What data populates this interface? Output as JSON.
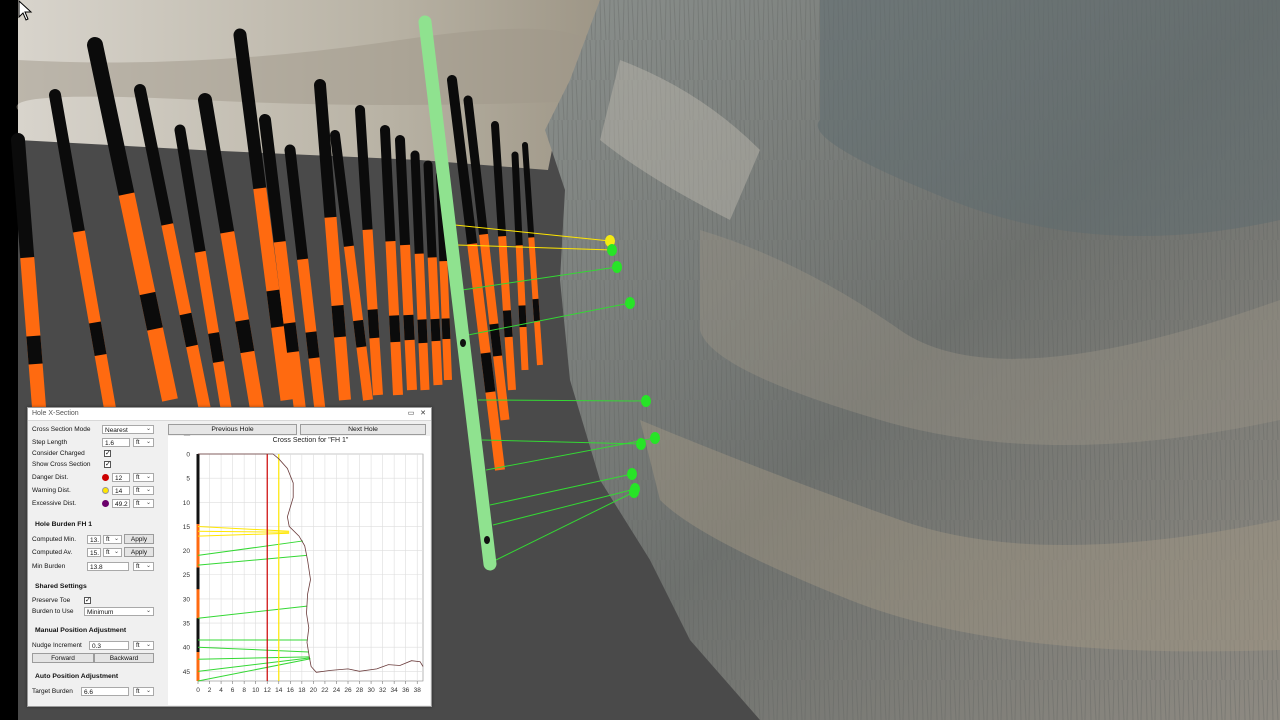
{
  "colors": {
    "green_hole": "#8fe28f",
    "orange": "#ff6a10",
    "danger": "#cc0000",
    "warning": "#ffe600",
    "excessive": "#6b006b"
  },
  "window": {
    "title": "Hole X-Section",
    "minimize": "▭",
    "close": "✕"
  },
  "navigation": {
    "previous": "Previous Hole",
    "next": "Next Hole"
  },
  "settings": {
    "cross_section_mode": {
      "label": "Cross Section Mode",
      "value": "Nearest"
    },
    "step_length": {
      "label": "Step Length",
      "value": "1.6",
      "unit": "ft"
    },
    "consider_charged": {
      "label": "Consider Charged",
      "checked": "✓"
    },
    "show_cross_section": {
      "label": "Show Cross Section",
      "checked": "✓"
    },
    "danger": {
      "label": "Danger Dist.",
      "value": "12",
      "unit": "ft"
    },
    "warning": {
      "label": "Warning Dist.",
      "value": "14",
      "unit": "ft"
    },
    "excessive": {
      "label": "Excessive Dist.",
      "value": "49.2",
      "unit": "ft"
    }
  },
  "hole_burden": {
    "heading": "Hole Burden  FH 1",
    "computed_min": {
      "label": "Computed Min.",
      "value": "13.",
      "unit": "ft",
      "apply": "Apply"
    },
    "computed_av": {
      "label": "Computed Av.",
      "value": "15.",
      "unit": "ft",
      "apply": "Apply"
    },
    "min_burden": {
      "label": "Min Burden",
      "value": "13.8",
      "unit": "ft"
    }
  },
  "shared": {
    "heading": "Shared Settings",
    "preserve_toe": {
      "label": "Preserve Toe",
      "checked": "✓"
    },
    "burden_to_use": {
      "label": "Burden to Use",
      "value": "Minimum"
    }
  },
  "manual": {
    "heading": "Manual Position Adjustment",
    "nudge": {
      "label": "Nudge Increment",
      "value": "0.3",
      "unit": "ft"
    },
    "forward": "Forward",
    "backward": "Backward"
  },
  "auto": {
    "heading": "Auto Position Adjustment",
    "target_burden": {
      "label": "Target Burden",
      "value": "6.6",
      "unit": "ft"
    }
  },
  "chart_data": {
    "type": "line",
    "title": "Cross Section for \"FH 1\"",
    "xlim": [
      0,
      39
    ],
    "ylim": [
      0,
      47
    ],
    "y_inverted": true,
    "x_ticks": [
      "0",
      "2",
      "4",
      "6",
      "8",
      "10",
      "12",
      "14",
      "16",
      "18",
      "20",
      "22",
      "24",
      "26",
      "28",
      "30",
      "32",
      "34",
      "36",
      "38"
    ],
    "y_ticks": [
      "0",
      "5",
      "10",
      "15",
      "20",
      "25",
      "30",
      "35",
      "40",
      "45"
    ],
    "danger_line_x": 12,
    "warning_line_x": 14,
    "hole_charge_segments": [
      [
        14.5,
        23.5
      ],
      [
        28,
        34
      ],
      [
        41,
        47
      ]
    ],
    "face_profile": [
      [
        0,
        0
      ],
      [
        13,
        0
      ],
      [
        14,
        1
      ],
      [
        15.5,
        3
      ],
      [
        16.5,
        6
      ],
      [
        16.5,
        9
      ],
      [
        16,
        11
      ],
      [
        15.5,
        13
      ],
      [
        15.8,
        15
      ],
      [
        17.5,
        17
      ],
      [
        18.5,
        19
      ],
      [
        19,
        22
      ],
      [
        19.5,
        26
      ],
      [
        19,
        29
      ],
      [
        18.8,
        33
      ],
      [
        19.2,
        36
      ],
      [
        18.9,
        39
      ],
      [
        19.3,
        42
      ],
      [
        19.6,
        44
      ],
      [
        20.5,
        45.2
      ],
      [
        23,
        44.8
      ],
      [
        26,
        44.5
      ],
      [
        28,
        45
      ],
      [
        31,
        44.5
      ],
      [
        33,
        43.6
      ],
      [
        35,
        43.8
      ],
      [
        37,
        42.8
      ],
      [
        38.5,
        43
      ],
      [
        39,
        44
      ]
    ],
    "burden_rays": [
      {
        "from": [
          0,
          15
        ],
        "to": [
          15.8,
          16
        ],
        "color": "yellow"
      },
      {
        "from": [
          0,
          16
        ],
        "to": [
          15.8,
          16.2
        ],
        "color": "yellow"
      },
      {
        "from": [
          0,
          17
        ],
        "to": [
          15.8,
          16.4
        ],
        "color": "yellow"
      },
      {
        "from": [
          0,
          21
        ],
        "to": [
          18.2,
          18
        ],
        "color": "green"
      },
      {
        "from": [
          0,
          23
        ],
        "to": [
          18.8,
          21
        ],
        "color": "green"
      },
      {
        "from": [
          0,
          34
        ],
        "to": [
          18.9,
          31.5
        ],
        "color": "green"
      },
      {
        "from": [
          0,
          38.5
        ],
        "to": [
          19,
          38.5
        ],
        "color": "green"
      },
      {
        "from": [
          0,
          40
        ],
        "to": [
          19.2,
          41
        ],
        "color": "green"
      },
      {
        "from": [
          0,
          42.5
        ],
        "to": [
          19.3,
          42
        ],
        "color": "green"
      },
      {
        "from": [
          0,
          45
        ],
        "to": [
          19.4,
          42.2
        ],
        "color": "green"
      },
      {
        "from": [
          0,
          47
        ],
        "to": [
          19.5,
          42.4
        ],
        "color": "green"
      }
    ]
  }
}
